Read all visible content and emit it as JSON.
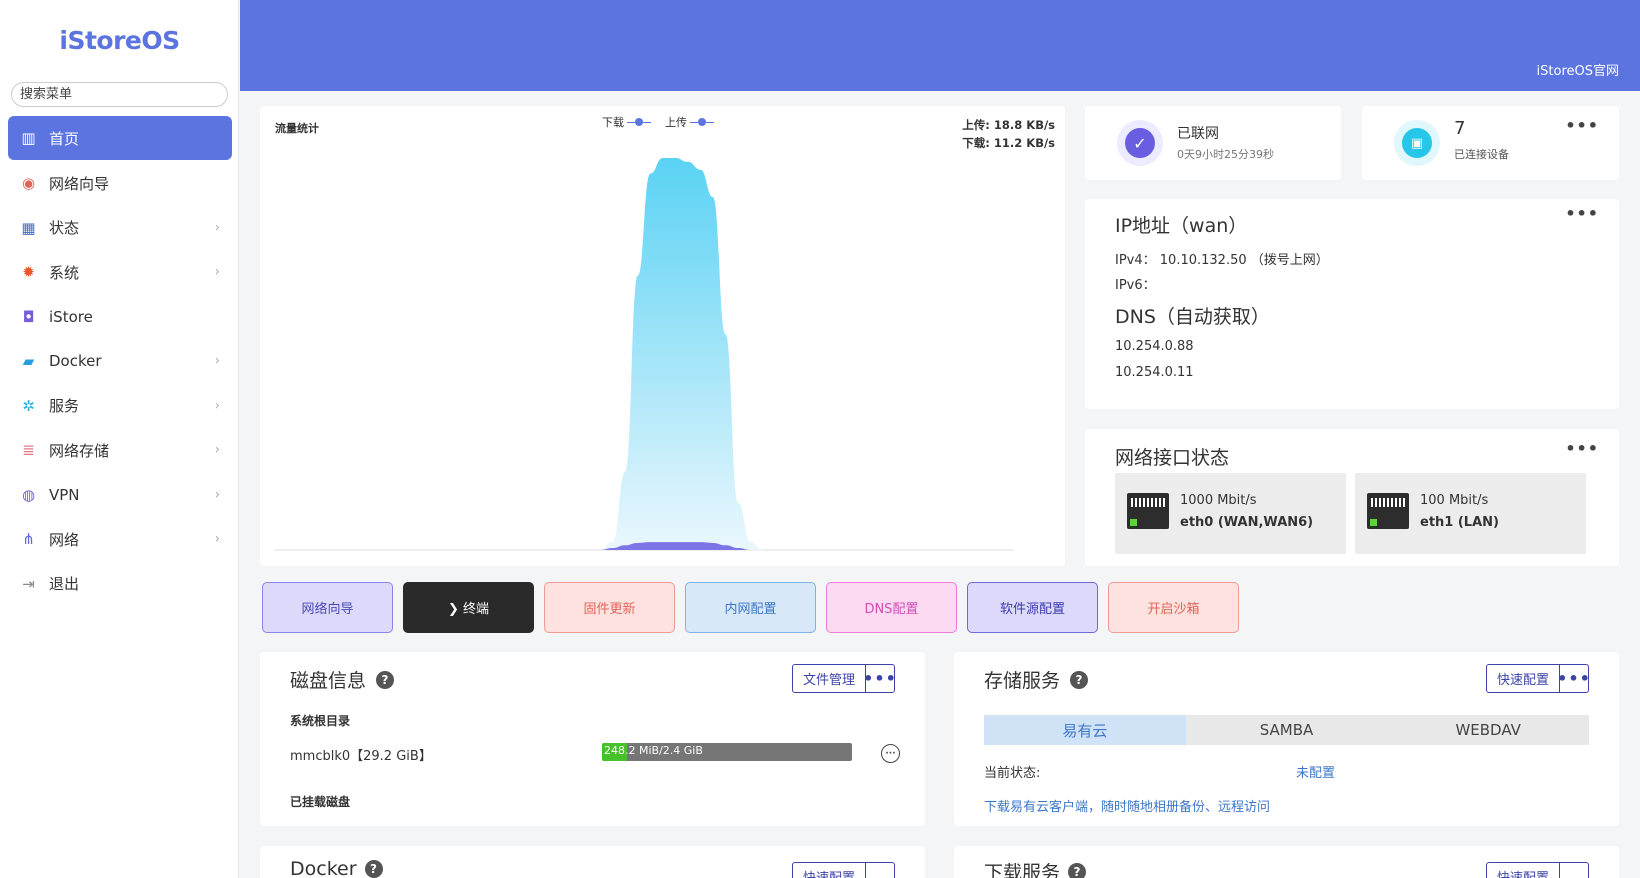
{
  "sidebar": {
    "logo": "iStoreOS",
    "search_placeholder": "搜索菜单",
    "items": [
      {
        "label": "首页",
        "icon": "chart-icon",
        "active": true,
        "has_children": false
      },
      {
        "label": "网络向导",
        "icon": "globe-pin-icon",
        "active": false,
        "has_children": false
      },
      {
        "label": "状态",
        "icon": "dashboard-icon",
        "active": false,
        "has_children": true
      },
      {
        "label": "系统",
        "icon": "gear-icon",
        "active": false,
        "has_children": true
      },
      {
        "label": "iStore",
        "icon": "shopping-bag-icon",
        "active": false,
        "has_children": false
      },
      {
        "label": "Docker",
        "icon": "docker-icon",
        "active": false,
        "has_children": true
      },
      {
        "label": "服务",
        "icon": "cogs-icon",
        "active": false,
        "has_children": true
      },
      {
        "label": "网络存储",
        "icon": "database-icon",
        "active": false,
        "has_children": true
      },
      {
        "label": "VPN",
        "icon": "vpn-icon",
        "active": false,
        "has_children": true
      },
      {
        "label": "网络",
        "icon": "network-tree-icon",
        "active": false,
        "has_children": true
      },
      {
        "label": "退出",
        "icon": "logout-icon",
        "active": false,
        "has_children": false
      }
    ]
  },
  "header": {
    "link": "iStoreOS官网",
    "color": "#5b74e0"
  },
  "traffic": {
    "title": "流量统计",
    "legend_download": "下载",
    "legend_upload": "上传",
    "upload_rate": "上传: 18.8 KB/s",
    "download_rate": "下载: 11.2 KB/s"
  },
  "chart_data": {
    "type": "area",
    "title": "流量统计",
    "series": [
      {
        "name": "下载",
        "values": [
          0,
          0,
          0,
          0,
          0,
          0,
          0,
          0,
          0,
          0,
          0,
          0,
          0,
          0,
          0,
          0,
          0,
          0,
          0,
          0,
          0,
          0,
          0,
          0,
          0,
          0,
          0,
          0.02,
          0.2,
          0.7,
          0.96,
          1,
          1,
          0.99,
          0.97,
          0.9,
          0.55,
          0.12,
          0.02,
          0,
          0,
          0,
          0,
          0,
          0,
          0,
          0,
          0,
          0,
          0,
          0,
          0,
          0,
          0,
          0,
          0,
          0,
          0,
          0,
          0
        ]
      },
      {
        "name": "上传",
        "values": [
          0,
          0,
          0,
          0,
          0,
          0,
          0,
          0,
          0,
          0,
          0,
          0,
          0,
          0,
          0,
          0,
          0,
          0,
          0,
          0,
          0,
          0,
          0,
          0,
          0,
          0,
          0,
          0.005,
          0.012,
          0.018,
          0.02,
          0.02,
          0.02,
          0.02,
          0.02,
          0.018,
          0.012,
          0.005,
          0,
          0,
          0,
          0,
          0,
          0,
          0,
          0,
          0,
          0,
          0,
          0,
          0,
          0,
          0,
          0,
          0,
          0,
          0,
          0,
          0,
          0
        ]
      }
    ],
    "colors": {
      "download_top": "#5ad2f4",
      "download_bottom": "#eaf7fd",
      "upload": "#6a5ee0"
    },
    "grid": false,
    "legend": "top-center"
  },
  "status": {
    "connection": {
      "label": "已联网",
      "uptime": "0天9小时25分39秒"
    },
    "devices": {
      "count": "7",
      "label": "已连接设备"
    }
  },
  "ip": {
    "title": "IP地址（wan）",
    "ipv4_label": "IPv4：",
    "ipv4_value": "10.10.132.50 （拨号上网）",
    "ipv6_label": "IPv6：",
    "dns_title": "DNS（自动获取）",
    "dns1": "10.254.0.88",
    "dns2": "10.254.0.11"
  },
  "interfaces": {
    "title": "网络接口状态",
    "ports": [
      {
        "speed": "1000 Mbit/s",
        "name": "eth0 (WAN,WAN6)"
      },
      {
        "speed": "100 Mbit/s",
        "name": "eth1 (LAN)"
      }
    ]
  },
  "quick_buttons": [
    {
      "label": "网络向导",
      "bg": "#dcd9fb",
      "border": "#8b84e8",
      "color": "#4a47b8"
    },
    {
      "label": "❯ 终端",
      "bg": "#2a2a2a",
      "border": "#2a2a2a",
      "color": "#ffffff"
    },
    {
      "label": "固件更新",
      "bg": "#fde2e0",
      "border": "#f09a93",
      "color": "#e0645a"
    },
    {
      "label": "内网配置",
      "bg": "#d8e8f8",
      "border": "#7fb2e6",
      "color": "#3d77c8"
    },
    {
      "label": "DNS配置",
      "bg": "#fbdaf2",
      "border": "#ee7ad7",
      "color": "#d14fb5"
    },
    {
      "label": "软件源配置",
      "bg": "#dcd9fb",
      "border": "#6f69d9",
      "color": "#3d3ab0"
    },
    {
      "label": "开启沙箱",
      "bg": "#fde2e0",
      "border": "#f09a93",
      "color": "#e0645a"
    }
  ],
  "disk": {
    "title": "磁盘信息",
    "file_manager": "文件管理",
    "root_label": "系统根目录",
    "device": "mmcblk0【29.2 GiB】",
    "usage_text": "248.2 MiB/2.4 GiB",
    "usage_fraction": 0.1,
    "mounted_label": "已挂载磁盘"
  },
  "storage": {
    "title": "存储服务",
    "quick_config": "快速配置",
    "tabs": [
      "易有云",
      "SAMBA",
      "WEBDAV"
    ],
    "status_label": "当前状态:",
    "status_value": "未配置",
    "download_link": "下载易有云客户端，随时随地相册备份、远程访问"
  },
  "peek": {
    "docker_title": "Docker",
    "download_title": "下载服务",
    "quick_config": "快速配置"
  }
}
